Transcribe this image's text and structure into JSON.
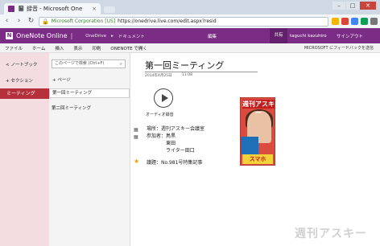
{
  "browser": {
    "tab_title": "📓 録音 - Microsoft One",
    "tab_close": "×",
    "url_secure_label": "Microsoft Corporation [US]",
    "url": "https://onedrive.live.com/edit.aspx?resid",
    "nav_back": "‹",
    "nav_forward": "›",
    "nav_reload": "↻",
    "win_min": "–",
    "win_max": "□",
    "win_close": "✕"
  },
  "header": {
    "logo": "N",
    "app_title": "OneNote Online",
    "app_separator": "|",
    "breadcrumb_root": "OneDrive",
    "breadcrumb_sep": "▸",
    "breadcrumb_folder": "ドキュメント",
    "mode": "編集",
    "share": "共有",
    "user": "taguchi kazuhiro",
    "signout": "サインアウト"
  },
  "ribbon": {
    "tabs": [
      "ファイル",
      "ホーム",
      "挿入",
      "表示",
      "印刷",
      "ONENOTE で開く"
    ],
    "feedback": "MICROSOFT にフィードバックを送信"
  },
  "notebook_pane": {
    "back_label": "< ノートブック",
    "add_section": "+ セクション",
    "active_section": "ミーティング"
  },
  "page_pane": {
    "search_placeholder": "このページで検索 (Ctrl+F)",
    "search_icon": "⌕",
    "add_page": "+ ページ",
    "pages": [
      "第一回ミーティング",
      "第二回ミーティング"
    ]
  },
  "page": {
    "title": "第一回ミーティング",
    "date": "2014年4月25日",
    "time": "11:08",
    "audio_label": "オーディオ録音",
    "details": [
      "場所：週刊アスキー会議室",
      "参加者：鳥黒",
      "　　　　東田",
      "　　　　ライター田口"
    ],
    "agenda": "議題：No.981号特集記事",
    "magazine_brand": "週刊アスキー",
    "magazine_headline": "スマホ"
  },
  "watermark": "週刊アスキー"
}
